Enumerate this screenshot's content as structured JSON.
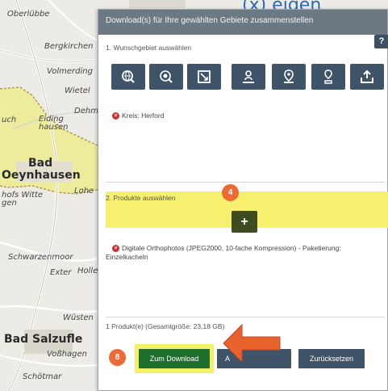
{
  "page_heading": "(x) eigen",
  "map": {
    "labels": [
      "Oberlübbe",
      "Bergkirchen",
      "Volmerding",
      "Wietel",
      "Dehme",
      "Eiding hausen",
      "uch",
      "Bad",
      "Oeynhausen",
      "Lohe",
      "hofs Witte gen",
      "Schwarzenmoor",
      "Exter",
      "Holler",
      "Wüsten",
      "Bad Salzufle",
      "Voßhagen",
      "Schötmar"
    ]
  },
  "dialog": {
    "title": "Download(s) für Ihre gewählten Gebiete zusammenstellen",
    "help_label": "?",
    "section1": {
      "title": "1. Wunschgebiet auswählen",
      "tool_icons": [
        "globe-search-icon",
        "target-search-icon",
        "rectangle-select-icon",
        "person-pin-icon",
        "location-pin-icon",
        "user-pin-icon",
        "upload-icon"
      ],
      "selection": "Kreis: Herford"
    },
    "section2": {
      "title": "2. Produkte auswählen",
      "step_badge": "4",
      "add_label": "+",
      "product": "Digitale Orthophotos (JPEG2000, 10-fache Kompression) - Paketierung: Einzelkacheln"
    },
    "footer": {
      "summary": "1 Produkt(e) (Gesamtgröße: 23,18 GB)",
      "step_badge": "8",
      "download_label": "Zum Download",
      "second_label": "A",
      "reset_label": "Zurücksetzen"
    }
  },
  "colors": {
    "header": "#6d7982",
    "button": "#3f5468",
    "download_button": "#1e6f2c",
    "highlight": "#f6f06e",
    "badge": "#ef6a33",
    "arrow": "#e8622e"
  }
}
